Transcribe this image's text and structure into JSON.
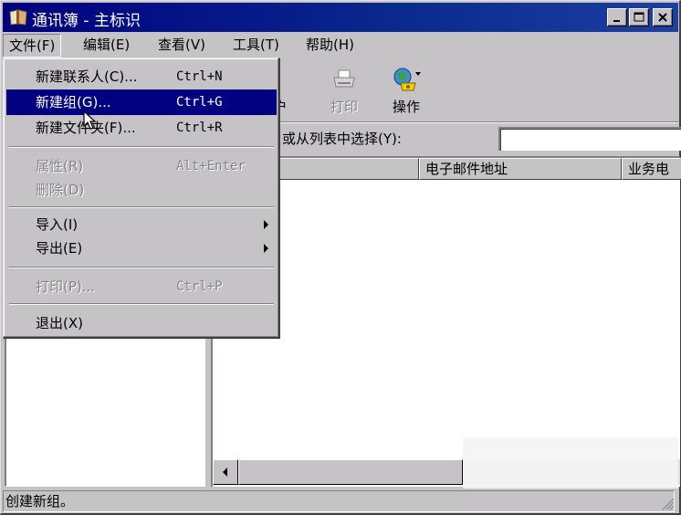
{
  "window": {
    "title": "通讯簿 - 主标识",
    "title_icon": "address-book-icon"
  },
  "menubar": {
    "items": [
      "文件(F)",
      "编辑(E)",
      "查看(V)",
      "工具(T)",
      "帮助(H)"
    ],
    "open_index": 0
  },
  "file_menu": {
    "items": [
      {
        "label": "新建联系人(C)...",
        "shortcut": "Ctrl+N",
        "enabled": true
      },
      {
        "label": "新建组(G)...",
        "shortcut": "Ctrl+G",
        "enabled": true,
        "selected": true
      },
      {
        "label": "新建文件夹(F)...",
        "shortcut": "Ctrl+R",
        "enabled": true
      },
      {
        "label": "属性(R)",
        "shortcut": "Alt+Enter",
        "enabled": false
      },
      {
        "label": "删除(D)",
        "shortcut": "",
        "enabled": false
      },
      {
        "label": "导入(I)",
        "shortcut": "",
        "enabled": true,
        "submenu": true
      },
      {
        "label": "导出(E)",
        "shortcut": "",
        "enabled": true,
        "submenu": true
      },
      {
        "label": "打印(P)...",
        "shortcut": "Ctrl+P",
        "enabled": false
      },
      {
        "label": "退出(X)",
        "shortcut": "",
        "enabled": true
      }
    ]
  },
  "toolbar": {
    "partial_label": "户",
    "print_label": "打印",
    "actions_label": "操作"
  },
  "search": {
    "label": "或从列表中选择(Y):",
    "value": ""
  },
  "list": {
    "columns": [
      "",
      "电子邮件地址",
      "业务电"
    ]
  },
  "status": {
    "text": "创建新组。"
  },
  "colors": {
    "title_bar": "#000080",
    "face": "#c6c3c6",
    "selection": "#000080",
    "disabled_text": "#848284"
  }
}
